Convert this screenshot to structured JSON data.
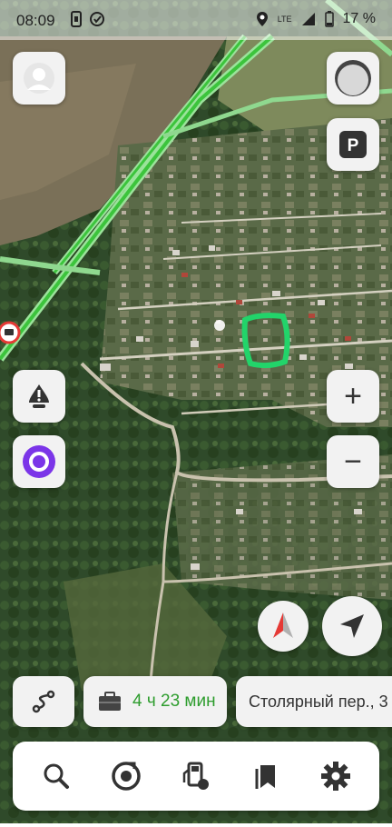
{
  "status_bar": {
    "time": "08:09",
    "network": "LTE",
    "battery": "17 %"
  },
  "route": {
    "eta": "4 ч 23 мин",
    "destination": "Столярный пер., 3"
  },
  "map_controls": {
    "zoom_in": "+",
    "zoom_out": "−"
  },
  "icons": [
    "avatar-icon",
    "traffic-icon",
    "parking-icon",
    "alert-icon",
    "alice-icon",
    "zoom-in-icon",
    "zoom-out-icon",
    "compass-icon",
    "locate-icon",
    "route-icon",
    "briefcase-icon",
    "search-icon",
    "music-icon",
    "fuel-icon",
    "bookmarks-icon",
    "settings-icon"
  ],
  "colors": {
    "highlight": "#22d46a",
    "eta_green": "#2e9d2e",
    "compass_red": "#e53935",
    "alice_purple": "#7b35e8"
  }
}
